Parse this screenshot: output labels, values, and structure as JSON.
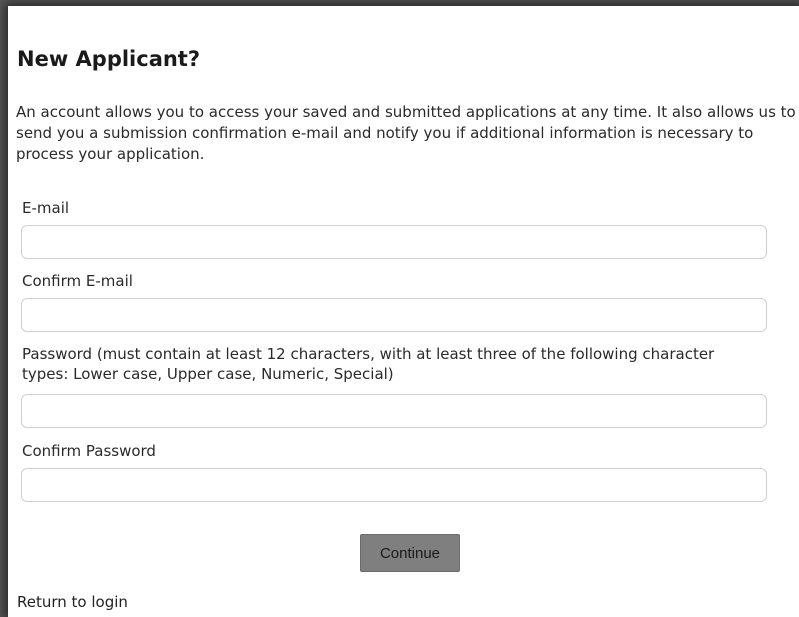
{
  "heading": "New Applicant?",
  "intro": "An account allows you to access your saved and submitted applications at any time. It also allows us to send you a submission confirmation e-mail and notify you if additional information is necessary to process your application.",
  "form": {
    "email": {
      "label": "E-mail",
      "value": ""
    },
    "confirm_email": {
      "label": "Confirm E-mail",
      "value": ""
    },
    "password": {
      "label": "Password (must contain at least 12 characters, with at least three of the following character types: Lower case, Upper case, Numeric, Special)",
      "value": ""
    },
    "confirm_password": {
      "label": "Confirm Password",
      "value": ""
    }
  },
  "continue_label": "Continue",
  "return_link": "Return to login"
}
